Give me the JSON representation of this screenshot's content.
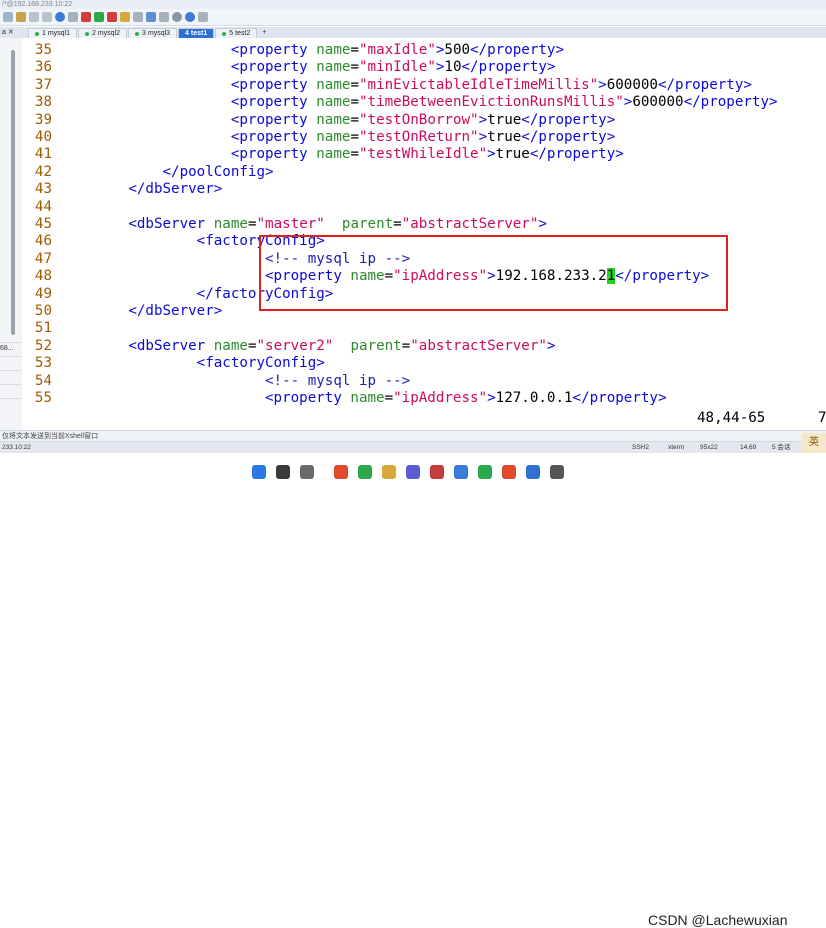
{
  "window": {
    "title": "/*@192.168.233.10:22"
  },
  "tabs": [
    {
      "label": "1 mysql1",
      "active": false
    },
    {
      "label": "2 mysql2",
      "active": false
    },
    {
      "label": "3 mysql3",
      "active": false
    },
    {
      "label": "4 test1",
      "active": true
    },
    {
      "label": "5 test2",
      "active": false
    }
  ],
  "tab_add": "+",
  "tab_close": "a ✕",
  "left_panel": {
    "item_value": "68...",
    "scroll_hint": ""
  },
  "lines": [
    {
      "num": "35",
      "parts": [
        [
          "ws",
          "                    "
        ],
        [
          "tag",
          "<property "
        ],
        [
          "an",
          "name"
        ],
        [
          "tx",
          "="
        ],
        [
          "av",
          "\"maxIdle\""
        ],
        [
          "tag",
          ">"
        ],
        [
          "tx",
          "500"
        ],
        [
          "tag",
          "</property>"
        ]
      ]
    },
    {
      "num": "36",
      "parts": [
        [
          "ws",
          "                    "
        ],
        [
          "tag",
          "<property "
        ],
        [
          "an",
          "name"
        ],
        [
          "tx",
          "="
        ],
        [
          "av",
          "\"minIdle\""
        ],
        [
          "tag",
          ">"
        ],
        [
          "tx",
          "10"
        ],
        [
          "tag",
          "</property>"
        ]
      ]
    },
    {
      "num": "37",
      "parts": [
        [
          "ws",
          "                    "
        ],
        [
          "tag",
          "<property "
        ],
        [
          "an",
          "name"
        ],
        [
          "tx",
          "="
        ],
        [
          "av",
          "\"minEvictableIdleTimeMillis\""
        ],
        [
          "tag",
          ">"
        ],
        [
          "tx",
          "600000"
        ],
        [
          "tag",
          "</property>"
        ]
      ]
    },
    {
      "num": "38",
      "parts": [
        [
          "ws",
          "                    "
        ],
        [
          "tag",
          "<property "
        ],
        [
          "an",
          "name"
        ],
        [
          "tx",
          "="
        ],
        [
          "av",
          "\"timeBetweenEvictionRunsMillis\""
        ],
        [
          "tag",
          ">"
        ],
        [
          "tx",
          "600000"
        ],
        [
          "tag",
          "</property>"
        ]
      ]
    },
    {
      "num": "39",
      "parts": [
        [
          "ws",
          "                    "
        ],
        [
          "tag",
          "<property "
        ],
        [
          "an",
          "name"
        ],
        [
          "tx",
          "="
        ],
        [
          "av",
          "\"testOnBorrow\""
        ],
        [
          "tag",
          ">"
        ],
        [
          "tx",
          "true"
        ],
        [
          "tag",
          "</property>"
        ]
      ]
    },
    {
      "num": "40",
      "parts": [
        [
          "ws",
          "                    "
        ],
        [
          "tag",
          "<property "
        ],
        [
          "an",
          "name"
        ],
        [
          "tx",
          "="
        ],
        [
          "av",
          "\"testOnReturn\""
        ],
        [
          "tag",
          ">"
        ],
        [
          "tx",
          "true"
        ],
        [
          "tag",
          "</property>"
        ]
      ]
    },
    {
      "num": "41",
      "parts": [
        [
          "ws",
          "                    "
        ],
        [
          "tag",
          "<property "
        ],
        [
          "an",
          "name"
        ],
        [
          "tx",
          "="
        ],
        [
          "av",
          "\"testWhileIdle\""
        ],
        [
          "tag",
          ">"
        ],
        [
          "tx",
          "true"
        ],
        [
          "tag",
          "</property>"
        ]
      ]
    },
    {
      "num": "42",
      "parts": [
        [
          "ws",
          "            "
        ],
        [
          "tag",
          "</poolConfig>"
        ]
      ]
    },
    {
      "num": "43",
      "parts": [
        [
          "ws",
          "        "
        ],
        [
          "tag",
          "</dbServer>"
        ]
      ]
    },
    {
      "num": "44",
      "parts": []
    },
    {
      "num": "45",
      "parts": [
        [
          "ws",
          "        "
        ],
        [
          "tag",
          "<dbServer "
        ],
        [
          "an",
          "name"
        ],
        [
          "tx",
          "="
        ],
        [
          "av",
          "\"master\""
        ],
        [
          "tx",
          "  "
        ],
        [
          "an",
          "parent"
        ],
        [
          "tx",
          "="
        ],
        [
          "av",
          "\"abstractServer\""
        ],
        [
          "tag",
          ">"
        ]
      ]
    },
    {
      "num": "46",
      "parts": [
        [
          "ws",
          "                "
        ],
        [
          "tag",
          "<factoryConfig>"
        ]
      ]
    },
    {
      "num": "47",
      "parts": [
        [
          "ws",
          "                        "
        ],
        [
          "cm",
          "<!-- mysql ip -->"
        ]
      ]
    },
    {
      "num": "48",
      "parts": [
        [
          "ws",
          "                        "
        ],
        [
          "tag",
          "<property "
        ],
        [
          "an",
          "name"
        ],
        [
          "tx",
          "="
        ],
        [
          "av",
          "\"ipAddress\""
        ],
        [
          "tag",
          ">"
        ],
        [
          "tx",
          "192.168.233.2"
        ],
        [
          "cursor",
          "1"
        ],
        [
          "tag",
          "</property>"
        ]
      ]
    },
    {
      "num": "49",
      "parts": [
        [
          "ws",
          "                "
        ],
        [
          "tag",
          "</factoryConfig>"
        ]
      ]
    },
    {
      "num": "50",
      "parts": [
        [
          "ws",
          "        "
        ],
        [
          "tag",
          "</dbServer>"
        ]
      ]
    },
    {
      "num": "51",
      "parts": []
    },
    {
      "num": "52",
      "parts": [
        [
          "ws",
          "        "
        ],
        [
          "tag",
          "<dbServer "
        ],
        [
          "an",
          "name"
        ],
        [
          "tx",
          "="
        ],
        [
          "av",
          "\"server2\""
        ],
        [
          "tx",
          "  "
        ],
        [
          "an",
          "parent"
        ],
        [
          "tx",
          "="
        ],
        [
          "av",
          "\"abstractServer\""
        ],
        [
          "tag",
          ">"
        ]
      ]
    },
    {
      "num": "53",
      "parts": [
        [
          "ws",
          "                "
        ],
        [
          "tag",
          "<factoryConfig>"
        ]
      ]
    },
    {
      "num": "54",
      "parts": [
        [
          "ws",
          "                        "
        ],
        [
          "cm",
          "<!-- mysql ip -->"
        ]
      ]
    },
    {
      "num": "55",
      "parts": [
        [
          "ws",
          "                        "
        ],
        [
          "tag",
          "<property "
        ],
        [
          "an",
          "name"
        ],
        [
          "tx",
          "="
        ],
        [
          "av",
          "\"ipAddress\""
        ],
        [
          "tag",
          ">"
        ],
        [
          "tx",
          "127.0.0.1"
        ],
        [
          "tag",
          "</property>"
        ]
      ]
    }
  ],
  "cursor_position": "48,44-65",
  "cursor_percent": "7",
  "status_line1": "仅将文本发送到当前Xshell窗口",
  "status_line2": {
    "host": "233.10:22",
    "ssh": "SSH2",
    "term": "xterm",
    "size": "95x22",
    "pos": "14,69",
    "sessions": "5 会话",
    "ime": "英"
  },
  "watermark": "CSDN @Lachewuxian",
  "colors": {
    "tag": "#0a0ad8",
    "attr_name": "#2e8b2e",
    "attr_value": "#cc0a5e",
    "line_number": "#a05a00",
    "highlight_box": "#e0201f",
    "cursor": "#22d422",
    "active_tab": "#2d6fd2"
  }
}
